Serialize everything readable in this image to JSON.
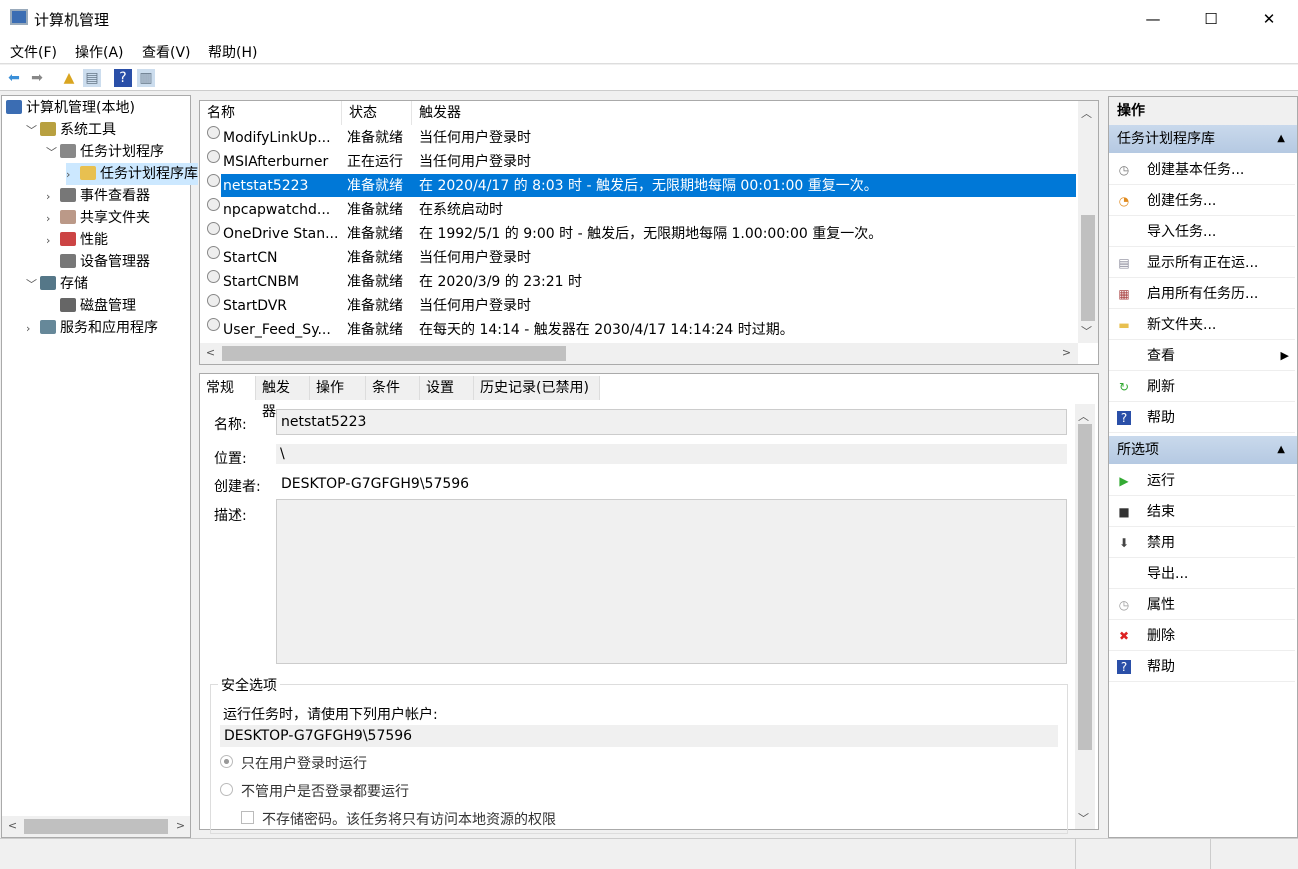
{
  "window": {
    "title": "计算机管理",
    "minimize": "—",
    "maximize": "☐",
    "close": "✕"
  },
  "menu": [
    "文件(F)",
    "操作(A)",
    "查看(V)",
    "帮助(H)"
  ],
  "tree": [
    {
      "label": "计算机管理(本地)",
      "level": 0,
      "exp": ""
    },
    {
      "label": "系统工具",
      "level": 1,
      "exp": "v"
    },
    {
      "label": "任务计划程序",
      "level": 2,
      "exp": "v"
    },
    {
      "label": "任务计划程序库",
      "level": 3,
      "exp": ">",
      "selected": true
    },
    {
      "label": "事件查看器",
      "level": 2,
      "exp": ">"
    },
    {
      "label": "共享文件夹",
      "level": 2,
      "exp": ">"
    },
    {
      "label": "性能",
      "level": 2,
      "exp": ">"
    },
    {
      "label": "设备管理器",
      "level": 2,
      "exp": ""
    },
    {
      "label": "存储",
      "level": 1,
      "exp": "v"
    },
    {
      "label": "磁盘管理",
      "level": 2,
      "exp": ""
    },
    {
      "label": "服务和应用程序",
      "level": 1,
      "exp": ">"
    }
  ],
  "list": {
    "headers": [
      "名称",
      "状态",
      "触发器"
    ],
    "rows": [
      [
        "ModifyLinkUp...",
        "准备就绪",
        "当任何用户登录时"
      ],
      [
        "MSIAfterburner",
        "正在运行",
        "当任何用户登录时"
      ],
      [
        "netstat5223",
        "准备就绪",
        "在 2020/4/17 的 8:03 时 - 触发后，无限期地每隔 00:01:00 重复一次。"
      ],
      [
        "npcapwatchd...",
        "准备就绪",
        "在系统启动时"
      ],
      [
        "OneDrive Stan...",
        "准备就绪",
        "在 1992/5/1 的 9:00 时 - 触发后，无限期地每隔 1.00:00:00 重复一次。"
      ],
      [
        "StartCN",
        "准备就绪",
        "当任何用户登录时"
      ],
      [
        "StartCNBM",
        "准备就绪",
        "在 2020/3/9 的 23:21 时"
      ],
      [
        "StartDVR",
        "准备就绪",
        "当任何用户登录时"
      ],
      [
        "User_Feed_Sy...",
        "准备就绪",
        "在每天的 14:14 - 触发器在 2030/4/17 14:14:24 时过期。"
      ]
    ],
    "selected_index": 2
  },
  "detail": {
    "tabs": [
      "常规",
      "触发器",
      "操作",
      "条件",
      "设置",
      "历史记录(已禁用)"
    ],
    "name_label": "名称:",
    "name_value": "netstat5223",
    "location_label": "位置:",
    "location_value": "\\",
    "author_label": "创建者:",
    "author_value": "DESKTOP-G7GFGH9\\57596",
    "desc_label": "描述:",
    "security_title": "安全选项",
    "run_as_label": "运行任务时，请使用下列用户帐户:",
    "run_as_value": "DESKTOP-G7GFGH9\\57596",
    "radio1": "只在用户登录时运行",
    "radio2": "不管用户是否登录都要运行",
    "checkbox": "不存储密码。该任务将只有访问本地资源的权限"
  },
  "actions": {
    "title": "操作",
    "section1": "任务计划程序库",
    "items1": [
      {
        "label": "创建基本任务...",
        "icon": "◷",
        "color": "#777"
      },
      {
        "label": "创建任务...",
        "icon": "◔",
        "color": "#e08a1e"
      },
      {
        "label": "导入任务...",
        "icon": "",
        "color": "#000"
      },
      {
        "label": "显示所有正在运...",
        "icon": "▤",
        "color": "#889"
      },
      {
        "label": "启用所有任务历...",
        "icon": "▦",
        "color": "#a44"
      },
      {
        "label": "新文件夹...",
        "icon": "▬",
        "color": "#e8c050"
      },
      {
        "label": "查看",
        "icon": "",
        "color": "#000"
      },
      {
        "label": "刷新",
        "icon": "↻",
        "color": "#3a3"
      },
      {
        "label": "帮助",
        "icon": "?",
        "color": "#fff"
      }
    ],
    "section2": "所选项",
    "items2": [
      {
        "label": "运行",
        "icon": "▶",
        "color": "#3a3"
      },
      {
        "label": "结束",
        "icon": "■",
        "color": "#333"
      },
      {
        "label": "禁用",
        "icon": "⬇",
        "color": "#444"
      },
      {
        "label": "导出...",
        "icon": "",
        "color": "#000"
      },
      {
        "label": "属性",
        "icon": "◷",
        "color": "#999"
      },
      {
        "label": "删除",
        "icon": "✖",
        "color": "#d22"
      },
      {
        "label": "帮助",
        "icon": "?",
        "color": "#fff"
      }
    ]
  }
}
